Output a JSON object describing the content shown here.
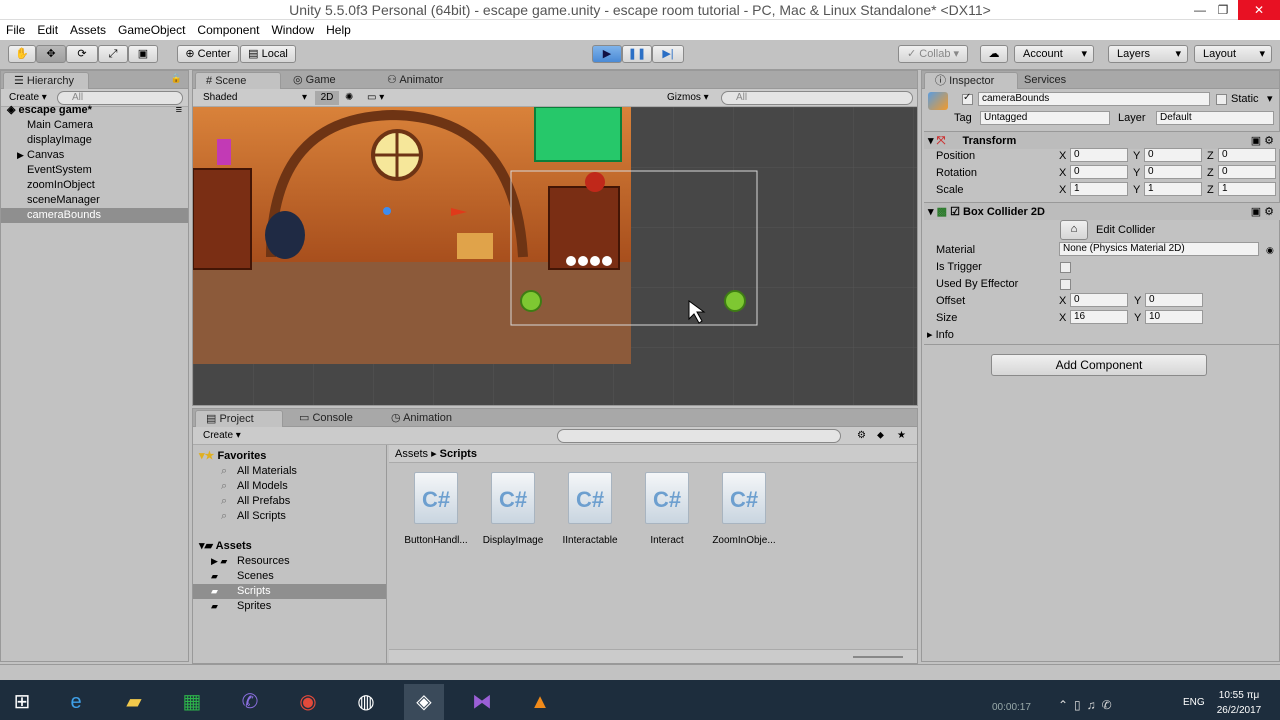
{
  "window": {
    "title": "Unity 5.5.0f3 Personal (64bit) - escape game.unity - escape room tutorial - PC, Mac & Linux Standalone* <DX11>"
  },
  "menu": [
    "File",
    "Edit",
    "Assets",
    "GameObject",
    "Component",
    "Window",
    "Help"
  ],
  "toolbar": {
    "center": "Center",
    "local": "Local",
    "collab": "Collab",
    "account": "Account",
    "layers": "Layers",
    "layout": "Layout"
  },
  "hierarchy": {
    "tab": "Hierarchy",
    "create": "Create",
    "search_placeholder": "All",
    "scene": "escape game*",
    "items": [
      "Main Camera",
      "displayImage",
      "Canvas",
      "EventSystem",
      "zoomInObject",
      "sceneManager",
      "cameraBounds"
    ]
  },
  "scene_view": {
    "tabs": [
      "Scene",
      "Game",
      "Animator"
    ],
    "shading": "Shaded",
    "mode": "2D",
    "gizmos": "Gizmos",
    "search_placeholder": "All"
  },
  "project": {
    "tabs": [
      "Project",
      "Console",
      "Animation"
    ],
    "create": "Create",
    "favorites_label": "Favorites",
    "favorites": [
      "All Materials",
      "All Models",
      "All Prefabs",
      "All Scripts"
    ],
    "assets_label": "Assets",
    "folders": [
      "Resources",
      "Scenes",
      "Scripts",
      "Sprites"
    ],
    "breadcrumb": [
      "Assets",
      "Scripts"
    ],
    "files": [
      "ButtonHandl...",
      "DisplayImage",
      "IInteractable",
      "Interact",
      "ZoomInObje..."
    ],
    "file_glyph": "C#"
  },
  "inspector": {
    "tabs": [
      "Inspector",
      "Services"
    ],
    "object_name": "cameraBounds",
    "static_label": "Static",
    "tag_label": "Tag",
    "tag_value": "Untagged",
    "layer_label": "Layer",
    "layer_value": "Default",
    "transform": {
      "title": "Transform",
      "rows": [
        {
          "label": "Position",
          "x": "0",
          "y": "0",
          "z": "0"
        },
        {
          "label": "Rotation",
          "x": "0",
          "y": "0",
          "z": "0"
        },
        {
          "label": "Scale",
          "x": "1",
          "y": "1",
          "z": "1"
        }
      ]
    },
    "collider": {
      "title": "Box Collider 2D",
      "edit": "Edit Collider",
      "material_label": "Material",
      "material_value": "None (Physics Material 2D)",
      "trigger_label": "Is Trigger",
      "effector_label": "Used By Effector",
      "offset_label": "Offset",
      "offset_x": "0",
      "offset_y": "0",
      "size_label": "Size",
      "size_x": "16",
      "size_y": "10",
      "info_label": "Info"
    },
    "add_component": "Add Component",
    "axis": {
      "x": "X",
      "y": "Y",
      "z": "Z"
    }
  },
  "status": {
    "time": "00:00:17",
    "clock": "10:55 πμ",
    "date": "26/2/2017",
    "lang": "ENG"
  }
}
